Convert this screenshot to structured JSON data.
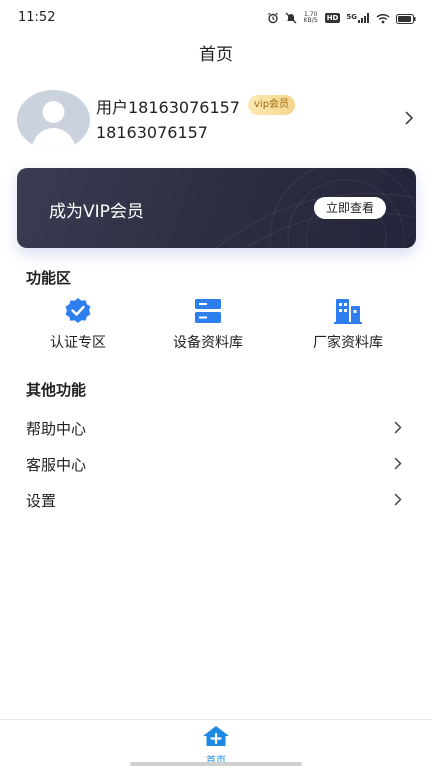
{
  "status_bar": {
    "time": "11:52",
    "net_speed_value": "1.70",
    "net_speed_unit": "KB/S",
    "hd_label": "HD",
    "network_label": "5G",
    "icons": [
      "alarm-icon",
      "mute-icon",
      "signal-icon",
      "wifi-icon",
      "battery-icon"
    ]
  },
  "header": {
    "title": "首页"
  },
  "profile": {
    "name": "用户18163076157",
    "vip_tag": "vip会员",
    "phone": "18163076157"
  },
  "vip_banner": {
    "title": "成为VIP会员",
    "button_label": "立即查看"
  },
  "functions": {
    "section_title": "功能区",
    "items": [
      {
        "label": "认证专区",
        "icon": "certification-badge-icon"
      },
      {
        "label": "设备资料库",
        "icon": "server-database-icon"
      },
      {
        "label": "厂家资料库",
        "icon": "building-icon"
      }
    ]
  },
  "other": {
    "section_title": "其他功能",
    "items": [
      {
        "label": "帮助中心"
      },
      {
        "label": "客服中心"
      },
      {
        "label": "设置"
      }
    ]
  },
  "bottom_nav": {
    "items": [
      {
        "label": "首页",
        "icon": "home-plus-icon"
      }
    ]
  },
  "colors": {
    "accent": "#1e88e5",
    "banner_bg": "#2c2d3f",
    "vip_tag_bg": "#f6d58a",
    "text": "#222222"
  }
}
